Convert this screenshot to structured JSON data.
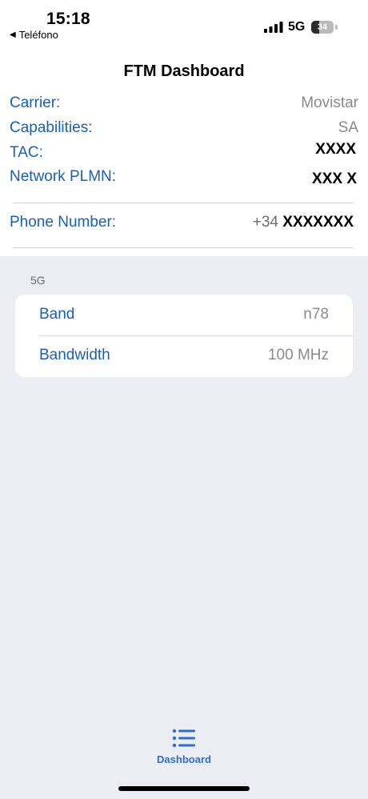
{
  "status_bar": {
    "time": "15:18",
    "back_app": "Teléfono",
    "network": "5G",
    "battery_level": "34",
    "battery_fraction": 0.34,
    "signal_bars": 4,
    "icons": {
      "back": "back-arrow-icon",
      "signal": "cellular-signal-icon",
      "battery": "battery-icon"
    }
  },
  "page": {
    "title": "FTM Dashboard"
  },
  "info": {
    "carrier_label": "Carrier:",
    "carrier_value": "Movistar",
    "capabilities_label": "Capabilities:",
    "capabilities_value": "SA",
    "tac_label": "TAC:",
    "tac_value": "XXXX",
    "plmn_label": "Network PLMN:",
    "plmn_value": "XXX X",
    "phone_label": "Phone Number:",
    "phone_prefix": "+34",
    "phone_value": "XXXXXXX"
  },
  "section": {
    "header": "5G",
    "band_label": "Band",
    "band_value": "n78",
    "bandwidth_label": "Bandwidth",
    "bandwidth_value": "100 MHz"
  },
  "tab_bar": {
    "dashboard_label": "Dashboard",
    "dashboard_icon": "list-icon"
  },
  "colors": {
    "label_blue": "#1a5fb4",
    "value_gray": "#8a8a8e",
    "tab_blue": "#2f6ec9",
    "background": "#ebedf3"
  }
}
